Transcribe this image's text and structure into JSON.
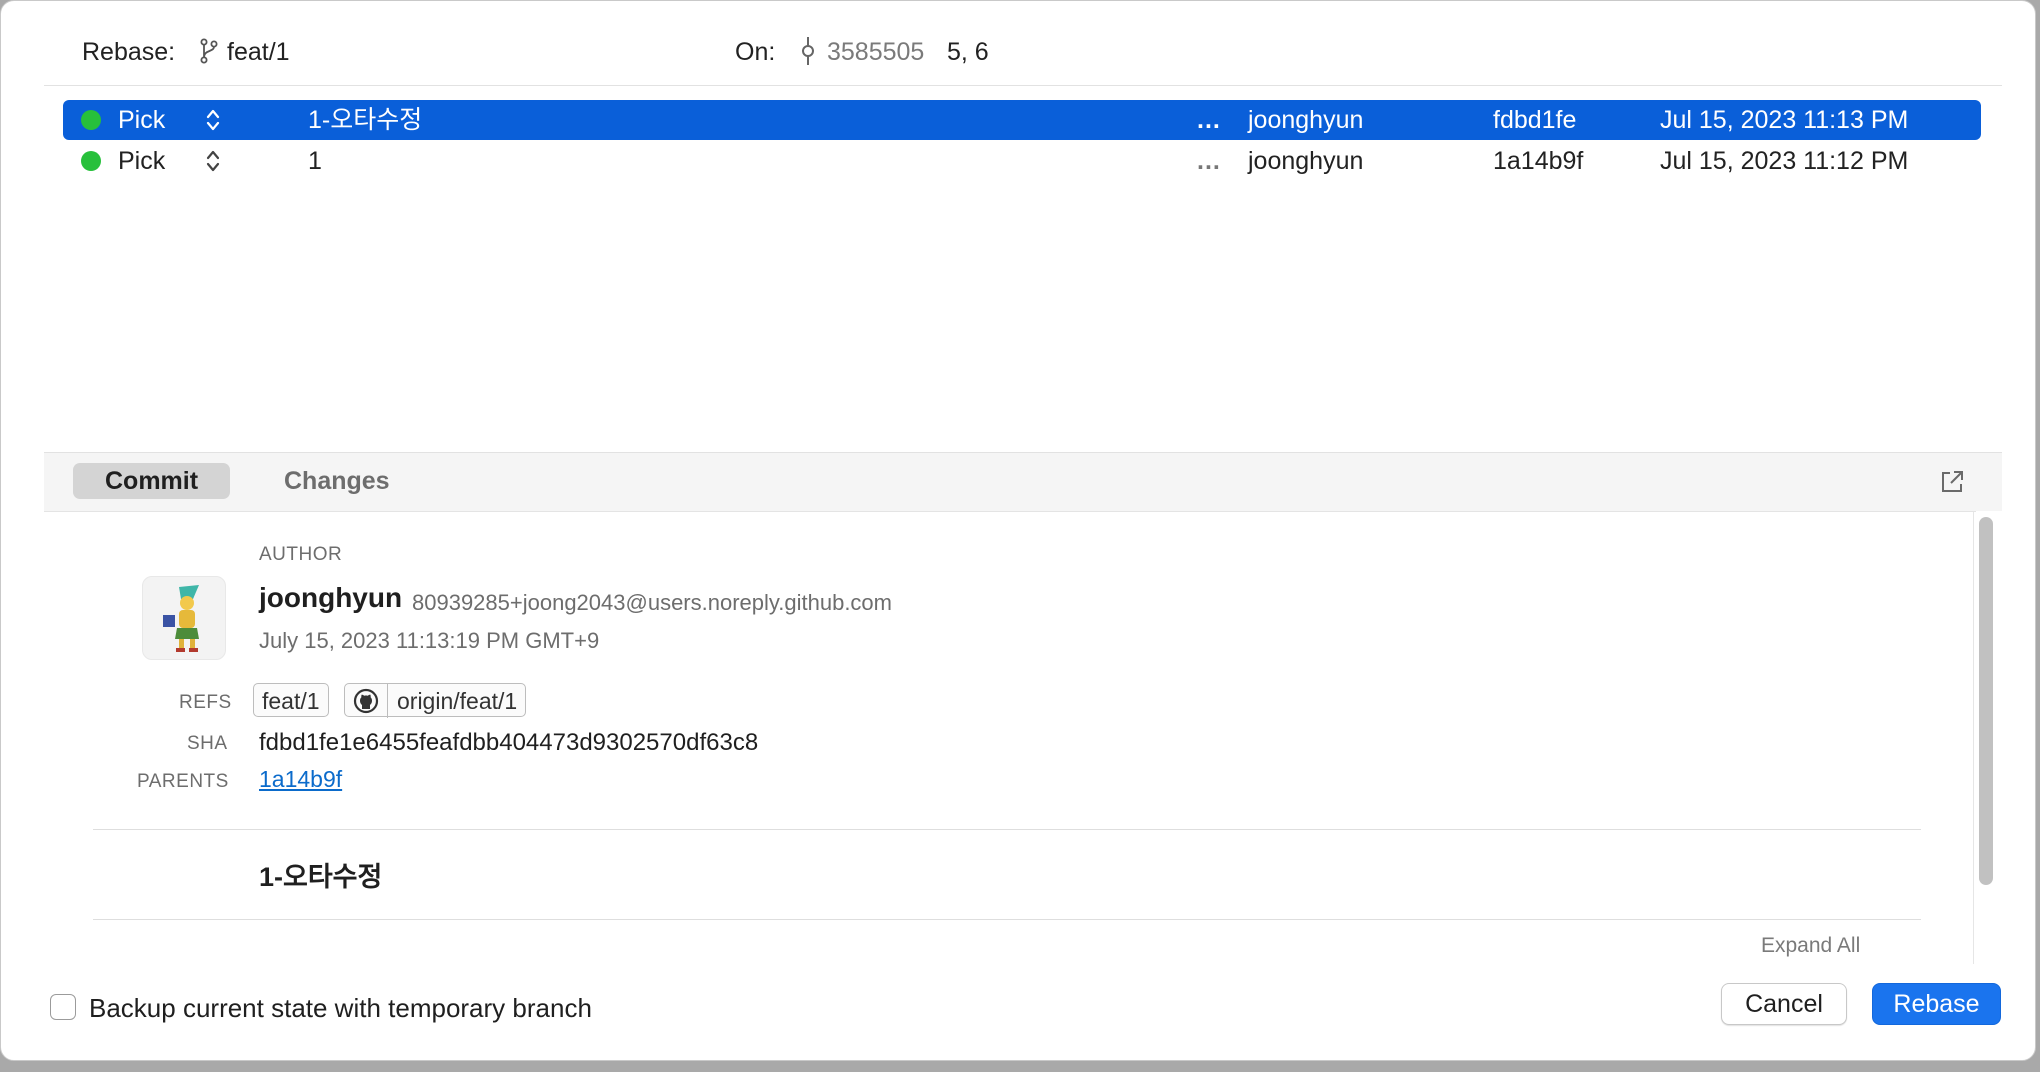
{
  "header": {
    "rebase_label": "Rebase:",
    "rebase_branch": "feat/1",
    "on_label": "On:",
    "on_sha": "3585505",
    "on_refs": "5, 6"
  },
  "commits": [
    {
      "action": "Pick",
      "message": "1-오타수정",
      "more": "...",
      "author": "joonghyun",
      "sha": "fdbd1fe",
      "date": "Jul 15, 2023 11:13 PM",
      "selected": true
    },
    {
      "action": "Pick",
      "message": "1",
      "more": "...",
      "author": "joonghyun",
      "sha": "1a14b9f",
      "date": "Jul 15, 2023 11:12 PM",
      "selected": false
    }
  ],
  "tabs": {
    "commit": "Commit",
    "changes": "Changes"
  },
  "detail": {
    "author_label": "AUTHOR",
    "author_name": "joonghyun",
    "author_email": "80939285+joong2043@users.noreply.github.com",
    "author_date": "July 15, 2023 11:13:19 PM GMT+9",
    "refs_label": "REFS",
    "refs": [
      "feat/1",
      "origin/feat/1"
    ],
    "sha_label": "SHA",
    "sha": "fdbd1fe1e6455feafdbb404473d9302570df63c8",
    "parents_label": "PARENTS",
    "parent": "1a14b9f",
    "message": "1-오타수정",
    "expand_all": "Expand All"
  },
  "footer": {
    "backup_label": "Backup current state with temporary branch",
    "backup_checked": false,
    "cancel": "Cancel",
    "rebase": "Rebase"
  },
  "colors": {
    "selection": "#0a5fd9",
    "status_dot": "#27c03b",
    "primary_button": "#1a74ee",
    "link": "#0b6bcb"
  },
  "icons": {
    "branch": "branch-icon",
    "commit": "commit-icon",
    "stepper": "up-down-chevron-icon",
    "popout": "open-external-icon",
    "github": "github-icon"
  }
}
